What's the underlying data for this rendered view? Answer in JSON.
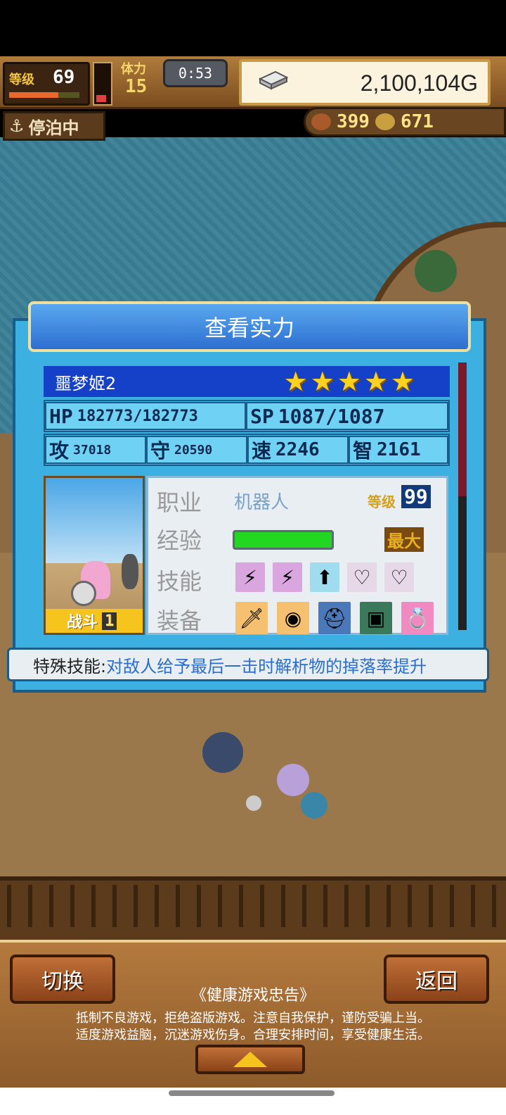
{
  "hud": {
    "level_label": "等级",
    "level_value": "69",
    "level_progress": 0.7,
    "stamina_label": "体力",
    "stamina_value": "15",
    "stamina_level": 0.2,
    "timer": "0:53",
    "gold": "2,100,104G",
    "anchor_status": "停泊中",
    "resource1": "399",
    "resource2": "671"
  },
  "dialog": {
    "title": "查看实力",
    "character_name": "噩梦姬2",
    "stars": [
      "★",
      "★",
      "★",
      "★",
      "★"
    ],
    "stats": {
      "hp_label": "HP",
      "hp_value": "182773/182773",
      "sp_label": "SP",
      "sp_value": "1087/1087",
      "atk_label": "攻",
      "atk_value": "37018",
      "def_label": "守",
      "def_value": "20590",
      "spd_label": "速",
      "spd_value": "2246",
      "int_label": "智",
      "int_value": "2161"
    },
    "portrait_tag": "战斗",
    "portrait_tag_num": "1",
    "info": {
      "job_label": "职业",
      "job_value": "机器人",
      "lv_label": "等级",
      "lv_value": "99",
      "exp_label": "经验",
      "exp_progress": 1.0,
      "exp_max": "最大",
      "skill_label": "技能",
      "equip_label": "装备",
      "skills": [
        {
          "icon": "lightning-icon",
          "glyph": "⚡",
          "color": "#d9a6e0"
        },
        {
          "icon": "lightning-icon",
          "glyph": "⚡",
          "color": "#d9a6e0"
        },
        {
          "icon": "arrow-up-icon",
          "glyph": "⬆",
          "color": "#9fdcf0"
        },
        {
          "icon": "heart-icon",
          "glyph": "♡",
          "color": "#e6d8e6"
        },
        {
          "icon": "heart-icon",
          "glyph": "♡",
          "color": "#e6d8e6"
        }
      ],
      "equipment": [
        {
          "icon": "sword-icon",
          "glyph": "🗡",
          "color": "#f5c070"
        },
        {
          "icon": "shield-icon",
          "glyph": "◉",
          "color": "#f5c070"
        },
        {
          "icon": "helmet-icon",
          "glyph": "⛑",
          "color": "#4a78b8"
        },
        {
          "icon": "armor-icon",
          "glyph": "▣",
          "color": "#3a7a5a"
        },
        {
          "icon": "ring-icon",
          "glyph": "💍",
          "color": "#f08ac0"
        }
      ]
    },
    "special_label": "特殊技能:",
    "special_text": "对敌人给予最后一击时解析物的掉落率提升"
  },
  "bottom": {
    "switch_label": "切换",
    "back_label": "返回",
    "notice_title": "《健康游戏忠告》",
    "notice_line1": "抵制不良游戏，拒绝盗版游戏。注意自我保护，谨防受骗上当。",
    "notice_line2": "适度游戏益脑，沉迷游戏伤身。合理安排时间，享受健康生活。"
  }
}
